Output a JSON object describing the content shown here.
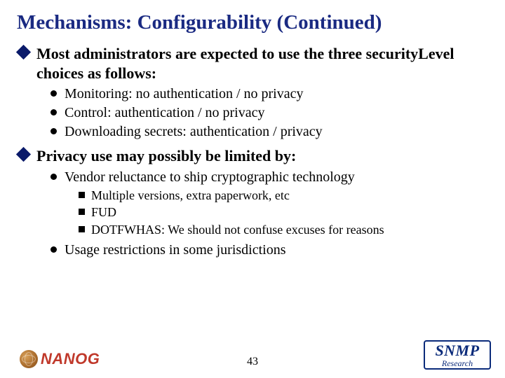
{
  "title": "Mechanisms:  Configurability (Continued)",
  "bullets": {
    "p1": "Most administrators are expected to use the three securityLevel choices as follows:",
    "p1_sub": [
      "Monitoring:  no authentication / no privacy",
      "Control:  authentication / no privacy",
      "Downloading secrets:  authentication / privacy"
    ],
    "p2": "Privacy use may possibly be limited by:",
    "p2_sub1": "Vendor reluctance to ship cryptographic technology",
    "p2_sub1_sub": [
      "Multiple versions, extra paperwork, etc",
      "FUD",
      "DOTFWHAS:  We should not confuse excuses for reasons"
    ],
    "p2_sub2": "Usage restrictions in some jurisdictions"
  },
  "footer": {
    "page": "43",
    "nanog": "NANOG",
    "snmp_main": "SNMP",
    "snmp_sub": "Research"
  }
}
